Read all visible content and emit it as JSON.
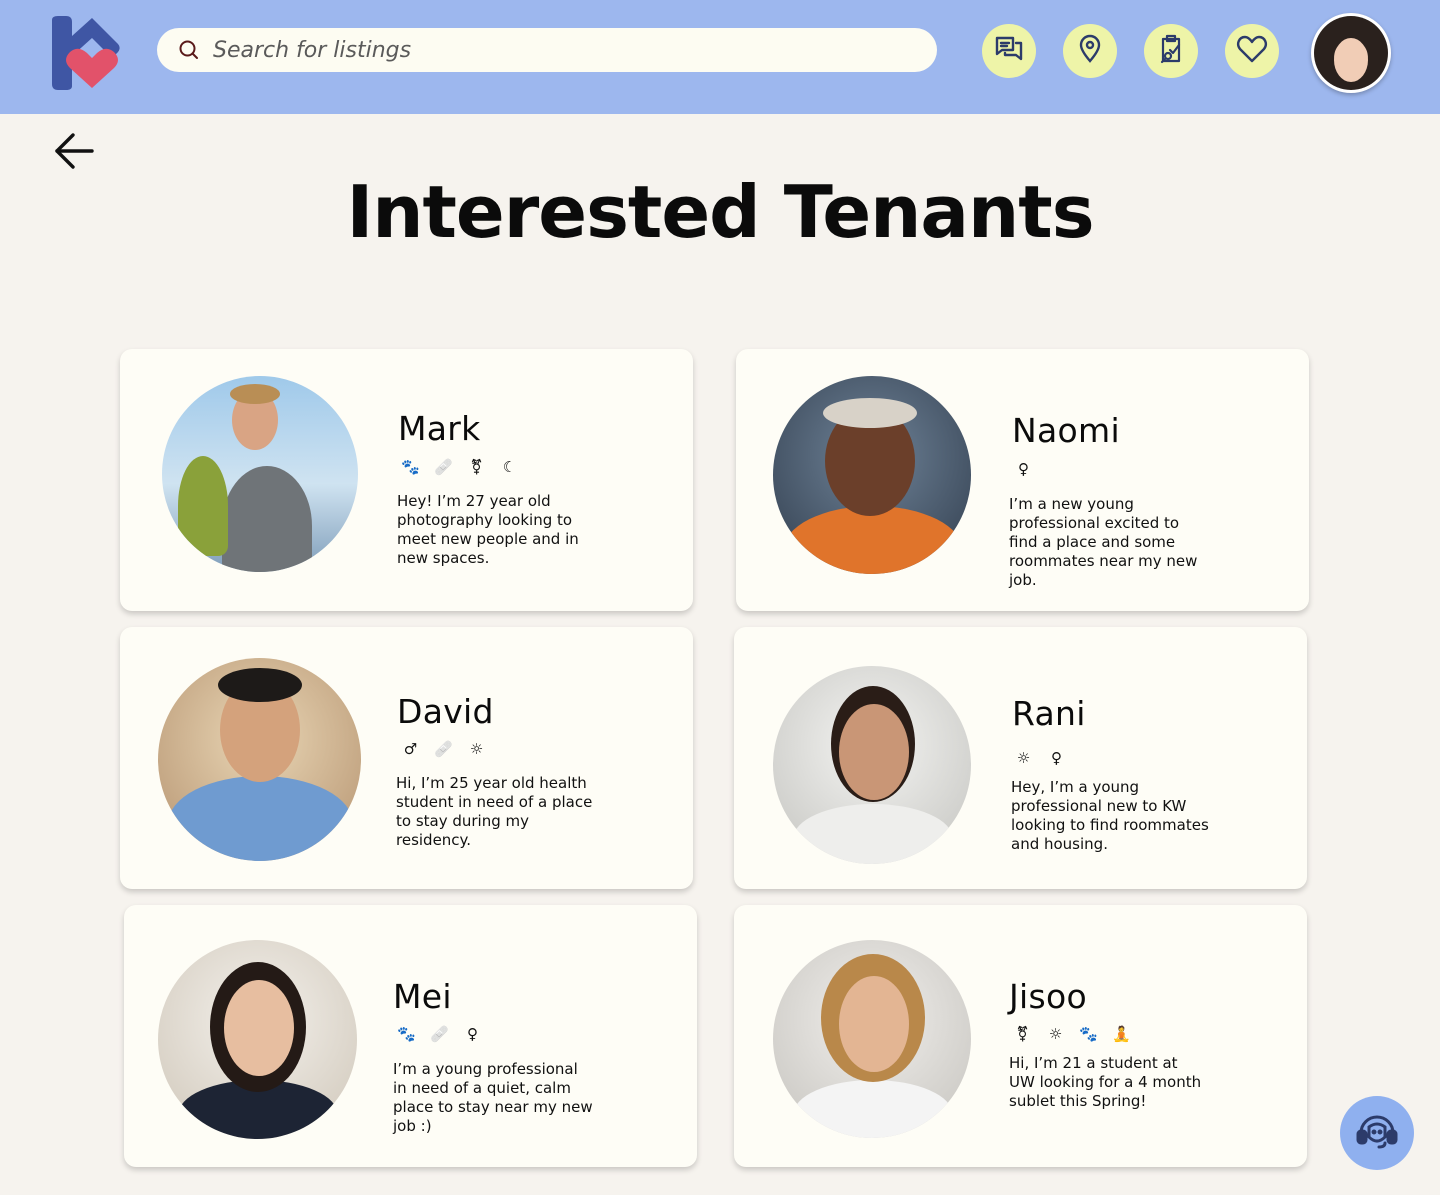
{
  "header": {
    "search_placeholder": "Search for listings",
    "icons": [
      "chat-icon",
      "location-pin-icon",
      "clipboard-search-icon",
      "heart-icon"
    ]
  },
  "page": {
    "title": "Interested Tenants"
  },
  "tenants": [
    {
      "name": "Mark",
      "traits": [
        "paw-icon",
        "bandage-icon",
        "transgender-icon",
        "moon-icon"
      ],
      "bio": "Hey! I’m 27 year old photography looking to meet new people and in new spaces."
    },
    {
      "name": "Naomi",
      "traits": [
        "female-icon"
      ],
      "bio": "I’m a new young professional excited to find a place and some roommates near my new job."
    },
    {
      "name": "David",
      "traits": [
        "male-icon",
        "bandage-icon",
        "sun-icon"
      ],
      "bio": "Hi, I’m 25 year old health student in need of a place to stay during my residency."
    },
    {
      "name": "Rani",
      "traits": [
        "sun-icon",
        "female-icon"
      ],
      "bio": "Hey, I’m a young professional new to KW looking to find roommates and housing."
    },
    {
      "name": "Mei",
      "traits": [
        "paw-icon",
        "bandage-icon",
        "female-icon"
      ],
      "bio": "I’m a young professional in need of a quiet, calm place to stay near my new job :)"
    },
    {
      "name": "Jisoo",
      "traits": [
        "transgender-icon",
        "sun-icon",
        "paw-icon",
        "person-meditating-icon"
      ],
      "bio": "Hi, I’m 21 a student at UW looking for a 4 month sublet this Spring!"
    }
  ],
  "colors": {
    "header_bg": "#9db7ee",
    "page_bg": "#f6f3ee",
    "card_bg": "#fefdf6",
    "icon_button_bg": "#eef4a8",
    "logo_blue": "#3f56a4",
    "logo_heart": "#e2526a",
    "support_bg": "#8fb0ef"
  }
}
